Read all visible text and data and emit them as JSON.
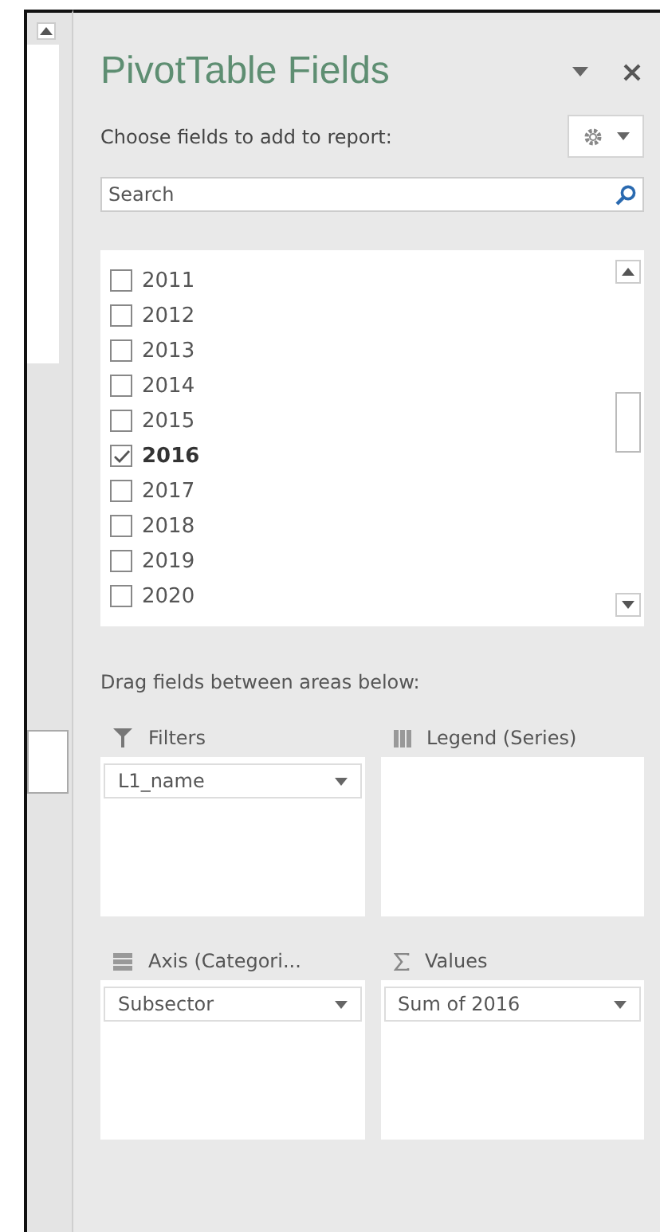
{
  "pane": {
    "title": "PivotTable Fields",
    "subtitle": "Choose fields to add to report:",
    "search": {
      "placeholder": "Search"
    }
  },
  "fields": [
    {
      "label": "2011",
      "checked": false
    },
    {
      "label": "2012",
      "checked": false
    },
    {
      "label": "2013",
      "checked": false
    },
    {
      "label": "2014",
      "checked": false
    },
    {
      "label": "2015",
      "checked": false
    },
    {
      "label": "2016",
      "checked": true
    },
    {
      "label": "2017",
      "checked": false
    },
    {
      "label": "2018",
      "checked": false
    },
    {
      "label": "2019",
      "checked": false
    },
    {
      "label": "2020",
      "checked": false
    }
  ],
  "areas_hint": "Drag fields between areas below:",
  "areas": [
    {
      "kind": "filter",
      "label": "Filters",
      "items": [
        "L1_name"
      ]
    },
    {
      "kind": "legend",
      "label": "Legend (Series)"
    },
    {
      "kind": "axis",
      "label": "Axis (Categori...",
      "items": [
        "Subsector"
      ]
    },
    {
      "kind": "values",
      "label": "Values",
      "items": [
        "Sum of 2016"
      ]
    }
  ]
}
